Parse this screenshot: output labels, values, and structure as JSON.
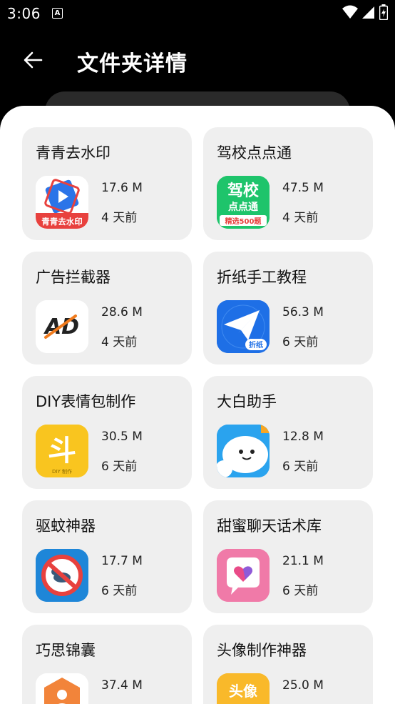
{
  "status_bar": {
    "time": "3:06",
    "notification_glyph": "A"
  },
  "header": {
    "title": "文件夹详情"
  },
  "apps": [
    {
      "name": "青青去水印",
      "size": "17.6 M",
      "time": "4 天前",
      "icon_text": "青青去水印"
    },
    {
      "name": "驾校点点通",
      "size": "47.5 M",
      "time": "4 天前",
      "icon_text_1": "驾校",
      "icon_text_2": "点点通",
      "icon_text_3": "精选500题"
    },
    {
      "name": "广告拦截器",
      "size": "28.6 M",
      "time": "4 天前",
      "icon_text": "AD"
    },
    {
      "name": "折纸手工教程",
      "size": "56.3 M",
      "time": "6 天前",
      "icon_text": "折纸"
    },
    {
      "name": "DIY表情包制作",
      "size": "30.5 M",
      "time": "6 天前",
      "icon_text": "斗",
      "icon_subtext": "DIY 制作"
    },
    {
      "name": "大白助手",
      "size": "12.8 M",
      "time": "6 天前"
    },
    {
      "name": "驱蚊神器",
      "size": "17.7 M",
      "time": "6 天前"
    },
    {
      "name": "甜蜜聊天话术库",
      "size": "21.1 M",
      "time": "6 天前"
    },
    {
      "name": "巧思锦囊",
      "size": "37.4 M",
      "time": ""
    },
    {
      "name": "头像制作神器",
      "size": "25.0 M",
      "time": "",
      "icon_text": "头像"
    }
  ]
}
